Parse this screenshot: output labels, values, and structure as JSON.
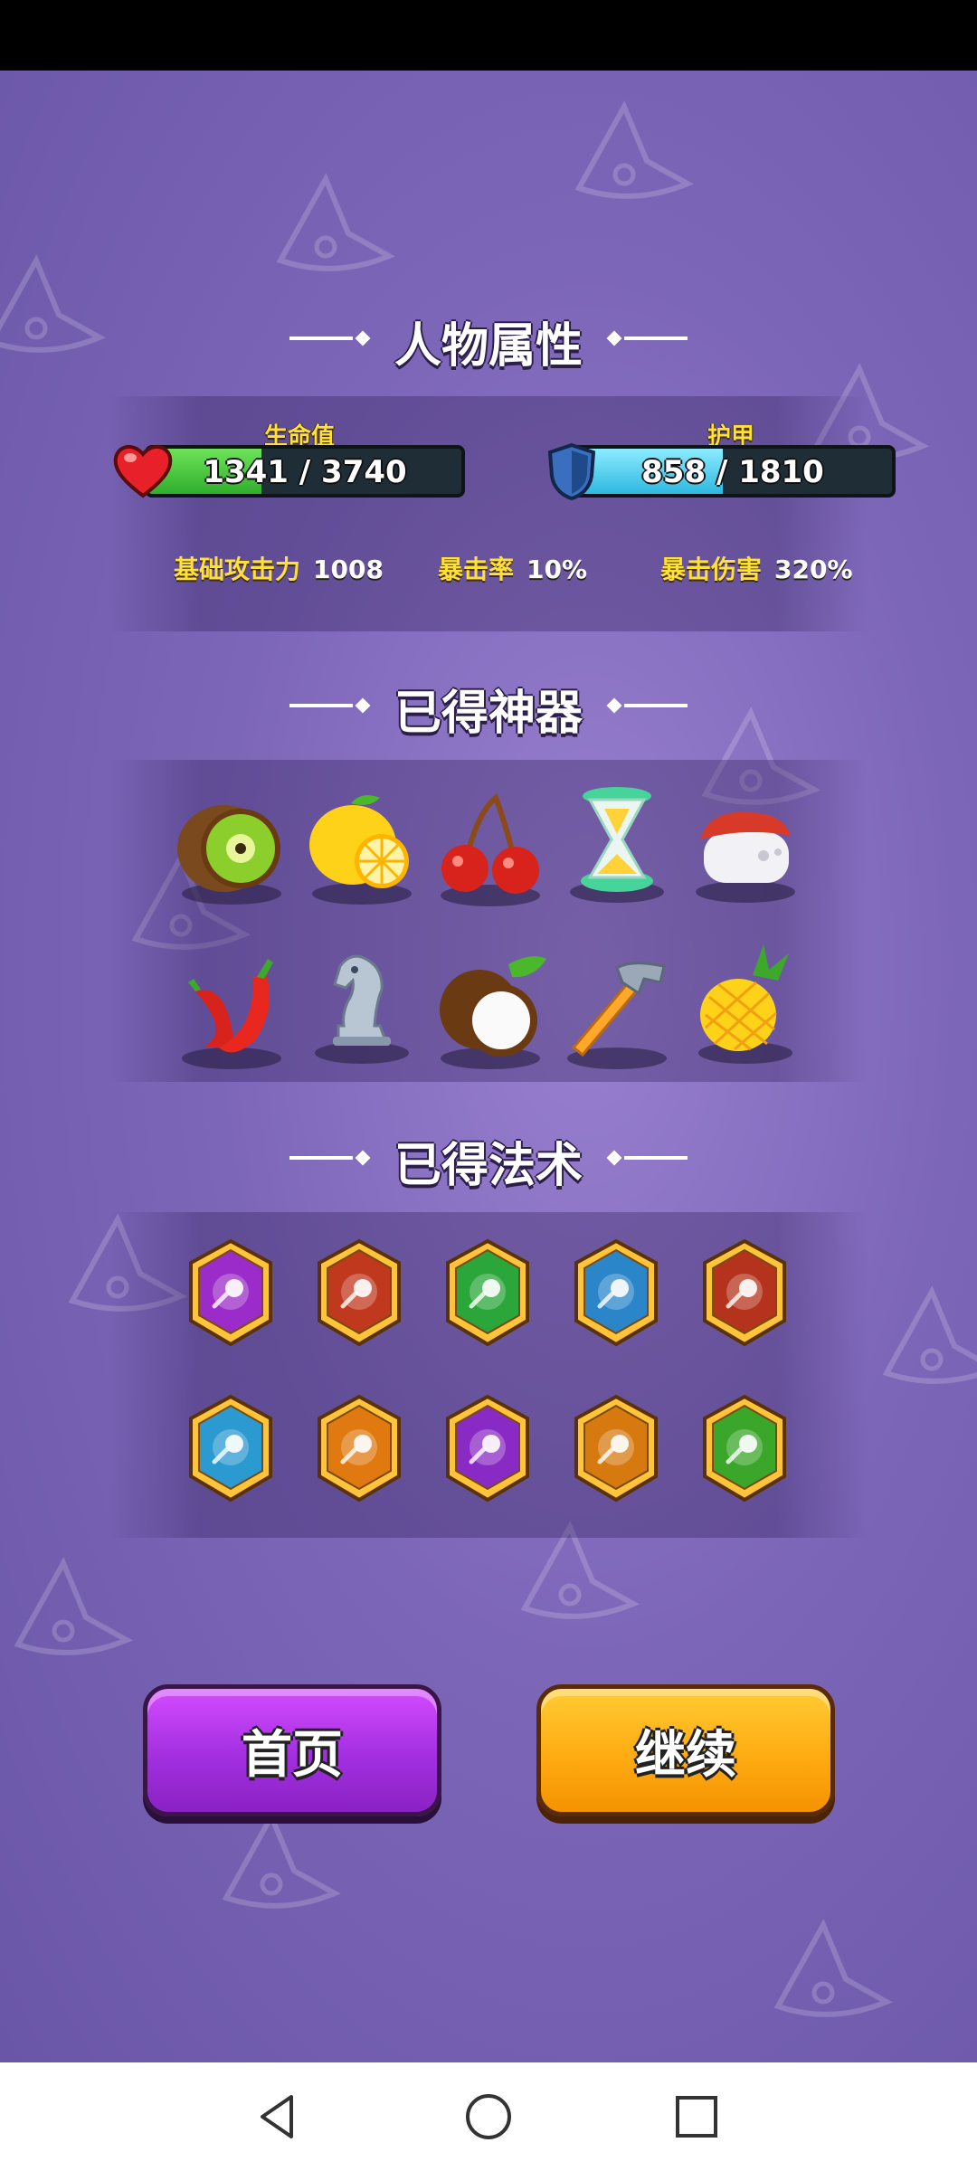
{
  "sections": {
    "attributes_title": "人物属性",
    "artifacts_title": "已得神器",
    "spells_title": "已得法术"
  },
  "health": {
    "label": "生命值",
    "current": "1341",
    "max": "3740",
    "text": "1341 / 3740",
    "fill_ratio": 0.36,
    "color": "#3cc83a"
  },
  "armor": {
    "label": "护甲",
    "current": "858",
    "max": "1810",
    "text": "858 / 1810",
    "fill_ratio": 0.47,
    "color": "#55d8f0"
  },
  "stats": [
    {
      "label": "基础攻击力",
      "value": "1008"
    },
    {
      "label": "暴击率",
      "value": "10%"
    },
    {
      "label": "暴击伤害",
      "value": "320%"
    }
  ],
  "artifacts": [
    {
      "icon": "kiwi-icon"
    },
    {
      "icon": "lemon-icon"
    },
    {
      "icon": "cherry-icon"
    },
    {
      "icon": "hourglass-icon"
    },
    {
      "icon": "sushi-icon"
    },
    {
      "icon": "chili-pepper-icon"
    },
    {
      "icon": "chess-knight-icon"
    },
    {
      "icon": "coconut-icon"
    },
    {
      "icon": "hammer-icon"
    },
    {
      "icon": "pineapple-icon"
    }
  ],
  "spells": [
    {
      "icon": "purple-orb-spell-icon",
      "color": "#9b2cc9"
    },
    {
      "icon": "red-orb-spell-icon",
      "color": "#c0391e"
    },
    {
      "icon": "green-orb-spell-icon",
      "color": "#2aa63a"
    },
    {
      "icon": "blue-orb-spell-icon",
      "color": "#2a86c8"
    },
    {
      "icon": "fire-shield-spell-icon",
      "color": "#b5331c"
    },
    {
      "icon": "ice-shield-spell-icon",
      "color": "#2a9ad0"
    },
    {
      "icon": "orange-orb-spell-icon",
      "color": "#e07a10"
    },
    {
      "icon": "thermometer-shield-spell-icon",
      "color": "#8a2ac4"
    },
    {
      "icon": "lightning-shield-spell-icon",
      "color": "#d67a10"
    },
    {
      "icon": "poison-shield-spell-icon",
      "color": "#3aa62a"
    }
  ],
  "buttons": {
    "home": "首页",
    "continue": "继续"
  }
}
